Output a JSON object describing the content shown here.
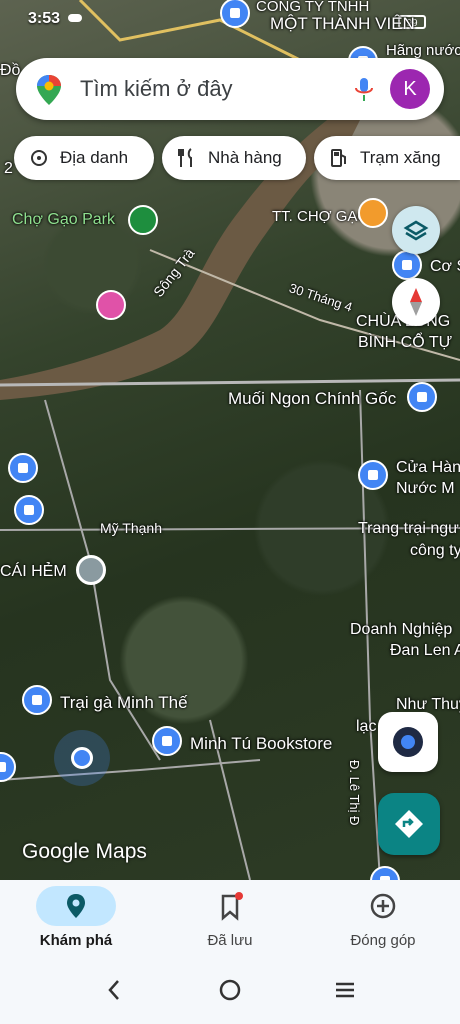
{
  "status_bar": {
    "time": "3:53",
    "battery": "99"
  },
  "search": {
    "placeholder": "Tìm kiếm ở đây",
    "avatar_letter": "K"
  },
  "chips": [
    {
      "label": "Địa danh",
      "icon": "landmark-icon"
    },
    {
      "label": "Nhà hàng",
      "icon": "restaurant-icon"
    },
    {
      "label": "Trạm xăng",
      "icon": "gas-station-icon"
    }
  ],
  "map_labels": {
    "cong_ty": "CÔNG TY TNHH",
    "mot_thanh_vien": "MỘT THÀNH VIÊN",
    "hang_nuoc": "Hãng nước",
    "do": "Đồ",
    "cho_gao_park": "Chợ Gạo Park",
    "tt_cho_gao": "TT. CHỢ GẠO",
    "co": "Cơ S",
    "song_tra": "Sông Trà",
    "thang_4": "30 Tháng 4",
    "chua_long": "CHÙA LONG",
    "binh_co_tu": "BÌNH CỔ TỰ",
    "muoi_ngon": "Muối Ngon Chính Gốc",
    "cua_hang": "Cửa Hàn",
    "nuoc_m": "Nước M",
    "my_thanh": "Mỹ Thạnh",
    "trang_trai": "Trang trại ngư",
    "cong_ty2": "công ty",
    "cai_hem": "CÁI HẺM",
    "doanh_nghiep": "Doanh Nghiệp",
    "dan_len": "Đan Len A",
    "nhu_thuy": "Như Thuỳ",
    "lac": "lạc",
    "trai_ga": "Trại gà Minh Thế",
    "minh_tu": "Minh Tú Bookstore",
    "le_thi": "Đ. Lê Thị Đ",
    "num2": "2"
  },
  "map_controls": {
    "layers": "layers-icon",
    "compass": "compass-icon",
    "my_location": "my-location-icon",
    "directions": "directions-icon"
  },
  "logo": "Google Maps",
  "bottom_nav": [
    {
      "label": "Khám phá",
      "icon": "explore-pin-icon",
      "active": true
    },
    {
      "label": "Đã lưu",
      "icon": "bookmark-icon",
      "active": false
    },
    {
      "label": "Đóng góp",
      "icon": "add-circle-icon",
      "active": false
    }
  ],
  "colors": {
    "accent": "#0b8484",
    "active_pill": "#c2e7ff",
    "avatar": "#9c27b0",
    "river": "#6b5a44"
  }
}
